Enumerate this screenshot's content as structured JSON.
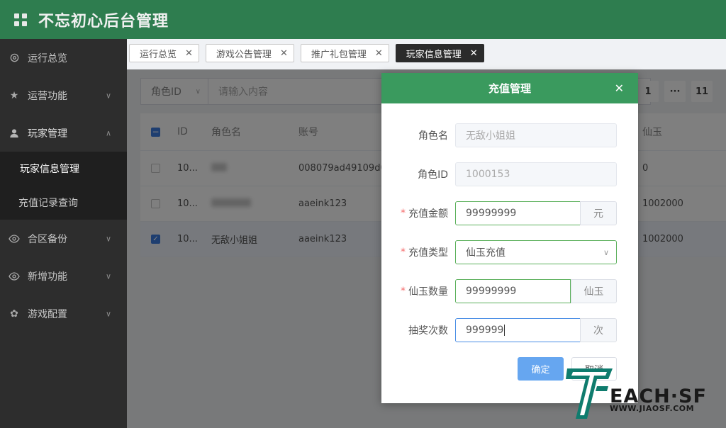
{
  "header": {
    "title": "不忘初心后台管理"
  },
  "sidebar": {
    "items": [
      {
        "label": "运行总览",
        "icon": "gear-icon"
      },
      {
        "label": "运营功能",
        "icon": "star-icon"
      },
      {
        "label": "玩家管理",
        "icon": "user-icon"
      },
      {
        "label": "合区备份",
        "icon": "eye-icon"
      },
      {
        "label": "新增功能",
        "icon": "eye-icon"
      },
      {
        "label": "游戏配置",
        "icon": "settings-icon"
      }
    ],
    "sub_items": [
      {
        "label": "玩家信息管理"
      },
      {
        "label": "充值记录查询"
      }
    ]
  },
  "tabs": [
    {
      "label": "运行总览"
    },
    {
      "label": "游戏公告管理"
    },
    {
      "label": "推广礼包管理"
    },
    {
      "label": "玩家信息管理"
    }
  ],
  "search": {
    "select_label": "角色ID",
    "placeholder": "请输入内容"
  },
  "pager": {
    "pages": [
      "1",
      "···",
      "11"
    ]
  },
  "table": {
    "headers": {
      "id": "ID",
      "role": "角色名",
      "account": "账号",
      "jade": "仙玉"
    },
    "rows": [
      {
        "id": "10...",
        "role": "",
        "account": "008079ad49109d0",
        "jade": "0"
      },
      {
        "id": "10...",
        "role": "",
        "account": "aaeink123",
        "jade": "1002000"
      },
      {
        "id": "10...",
        "role": "无敌小姐姐",
        "account": "aaeink123",
        "jade": "1002000"
      }
    ]
  },
  "modal": {
    "title": "充值管理",
    "fields": {
      "role_name": {
        "label": "角色名",
        "value": "无敌小姐姐"
      },
      "role_id": {
        "label": "角色ID",
        "value": "1000153"
      },
      "amount": {
        "label": "充值金额",
        "value": "99999999",
        "unit": "元"
      },
      "type": {
        "label": "充值类型",
        "value": "仙玉充值"
      },
      "jade": {
        "label": "仙玉数量",
        "value": "99999999",
        "unit": "仙玉"
      },
      "draws": {
        "label": "抽奖次数",
        "value": "999999",
        "unit": "次"
      }
    },
    "ok_label": "确定",
    "cancel_label": "取消"
  },
  "watermark": {
    "main": "EACH·SF",
    "sub": "WWW.JIAOSF.COM"
  },
  "colors": {
    "header": "#2e7d4f",
    "modal_header": "#3a9a5e",
    "primary": "#66a6f0",
    "sidebar": "#2d2d2d"
  }
}
